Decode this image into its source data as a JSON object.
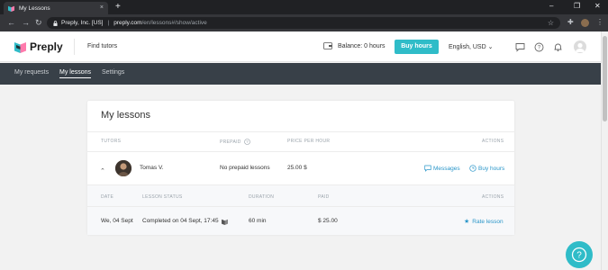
{
  "browser": {
    "tab_title": "My Lessons",
    "tab_close": "×",
    "new_tab": "+",
    "site_identity": "Preply, Inc. [US]",
    "url_domain": "preply.com",
    "url_path": "/en/lessons#/show/active",
    "icons": [
      "back-icon",
      "forward-icon",
      "reload-icon",
      "lock-icon",
      "star-icon",
      "extensions-icon",
      "profile-icon",
      "menu-icon"
    ]
  },
  "header": {
    "logo_text": "Preply",
    "find_tutors": "Find tutors",
    "balance": "Balance: 0 hours",
    "buy_hours": "Buy hours",
    "language": "English, USD",
    "lang_chevron": "⌄"
  },
  "subnav": {
    "items": [
      {
        "label": "My requests"
      },
      {
        "label": "My lessons"
      },
      {
        "label": "Settings"
      }
    ],
    "active_index": 1
  },
  "lessons": {
    "title": "My lessons",
    "columns": {
      "tutors": "TUTORS",
      "prepaid": "PREPAID",
      "price": "PRICE PER HOUR",
      "actions": "ACTIONS"
    },
    "row": {
      "tutor_name": "Tomas V.",
      "prepaid": "No prepaid lessons",
      "price": "25.00 $",
      "messages": "Messages",
      "buy_hours": "Buy hours"
    },
    "sub_columns": {
      "date": "DATE",
      "status": "LESSON STATUS",
      "duration": "DURATION",
      "paid": "PAID",
      "actions": "ACTIONS"
    },
    "sub_row": {
      "date": "We, 04 Sept",
      "status": "Completed on 04 Sept, 17:45",
      "duration": "60 min",
      "paid": "$ 25.00",
      "rate": "Rate lesson"
    }
  },
  "colors": {
    "accent": "#2fbcc8",
    "link": "#2a96c9",
    "subnav_bg": "#384048"
  }
}
